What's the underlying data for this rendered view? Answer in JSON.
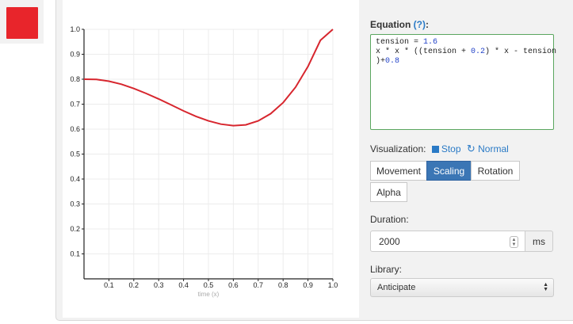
{
  "preview": {
    "color": "#e8252b"
  },
  "chart_data": {
    "type": "line",
    "xlabel": "time (x)",
    "ylabel": "",
    "xlim": [
      0,
      1
    ],
    "ylim": [
      0,
      1
    ],
    "x_ticks": [
      "0.1",
      "0.2",
      "0.3",
      "0.4",
      "0.5",
      "0.6",
      "0.7",
      "0.8",
      "0.9",
      "1.0"
    ],
    "y_ticks": [
      "0.1",
      "0.2",
      "0.3",
      "0.4",
      "0.5",
      "0.6",
      "0.7",
      "0.8",
      "0.9",
      "1.0"
    ],
    "grid": true,
    "series": [
      {
        "color": "#d7262e",
        "x": [
          0,
          0.05,
          0.1,
          0.15,
          0.2,
          0.25,
          0.3,
          0.35,
          0.4,
          0.45,
          0.5,
          0.55,
          0.6,
          0.65,
          0.7,
          0.75,
          0.8,
          0.85,
          0.9,
          0.95,
          1.0
        ],
        "y": [
          0.8,
          0.799,
          0.792,
          0.78,
          0.763,
          0.743,
          0.721,
          0.697,
          0.673,
          0.651,
          0.633,
          0.62,
          0.614,
          0.617,
          0.633,
          0.662,
          0.706,
          0.768,
          0.851,
          0.956,
          1.0
        ]
      }
    ]
  },
  "equation": {
    "label": "Equation",
    "help": "(?)",
    "suffix": ":",
    "line1_a": "tension = ",
    "line1_num": "1.6",
    "line2_a": "x * x * ((tension + ",
    "line2_num": "0.2",
    "line2_b": ") * x - tension",
    "line3_a": ")+",
    "line3_num": "0.8"
  },
  "visualization": {
    "label": "Visualization:",
    "stop_label": "Stop",
    "normal_label": "Normal",
    "tabs": [
      "Movement",
      "Scaling",
      "Rotation",
      "Alpha"
    ],
    "active": "Scaling"
  },
  "duration": {
    "label": "Duration:",
    "value": "2000",
    "unit": "ms"
  },
  "library": {
    "label": "Library:",
    "value": "Anticipate"
  }
}
